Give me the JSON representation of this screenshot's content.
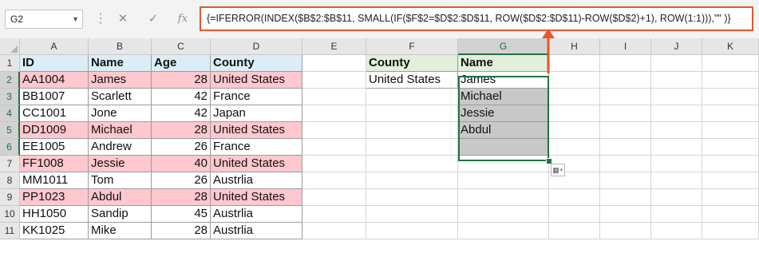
{
  "formula_bar": {
    "name_box": "G2",
    "dots": "⋮",
    "cancel": "✕",
    "enter": "✓",
    "fx": "fx",
    "formula": "{=IFERROR(INDEX($B$2:$B$11, SMALL(IF($F$2=$D$2:$D$11, ROW($D$2:$D$11)-ROW($D$2)+1), ROW(1:1))),\"\" )}"
  },
  "columns": [
    "A",
    "B",
    "C",
    "D",
    "E",
    "F",
    "G",
    "H",
    "I",
    "J",
    "K"
  ],
  "rows": [
    "1",
    "2",
    "3",
    "4",
    "5",
    "6",
    "7",
    "8",
    "9",
    "10",
    "11"
  ],
  "table": {
    "headers": [
      "ID",
      "Name",
      "Age",
      "County"
    ],
    "records": [
      [
        "AA1004",
        "James",
        "28",
        "United States"
      ],
      [
        "BB1007",
        "Scarlett",
        "42",
        "France"
      ],
      [
        "CC1001",
        "Jone",
        "42",
        "Japan"
      ],
      [
        "DD1009",
        "Michael",
        "28",
        "United States"
      ],
      [
        "EE1005",
        "Andrew",
        "26",
        "France"
      ],
      [
        "FF1008",
        "Jessie",
        "40",
        "United States"
      ],
      [
        "MM1011",
        "Tom",
        "26",
        "Austrlia"
      ],
      [
        "PP1023",
        "Abdul",
        "28",
        "United States"
      ],
      [
        "HH1050",
        "Sandip",
        "45",
        "Austrlia"
      ],
      [
        "KK1025",
        "Mike",
        "28",
        "Austrlia"
      ]
    ],
    "highlight_color": "#ffc7ce",
    "header_color": "#dbeef7"
  },
  "lookup": {
    "criteria_header": "County",
    "criteria_value": "United States",
    "result_header": "Name",
    "results": [
      "James",
      "Michael",
      "Jessie",
      "Abdul",
      ""
    ]
  },
  "colors": {
    "accent": "#217346",
    "arrow": "#e8562a",
    "lookup_header": "#e2efda",
    "result_fill": "#c8c8c8"
  },
  "icons": {
    "quick_analysis": "quick-analysis-icon"
  }
}
